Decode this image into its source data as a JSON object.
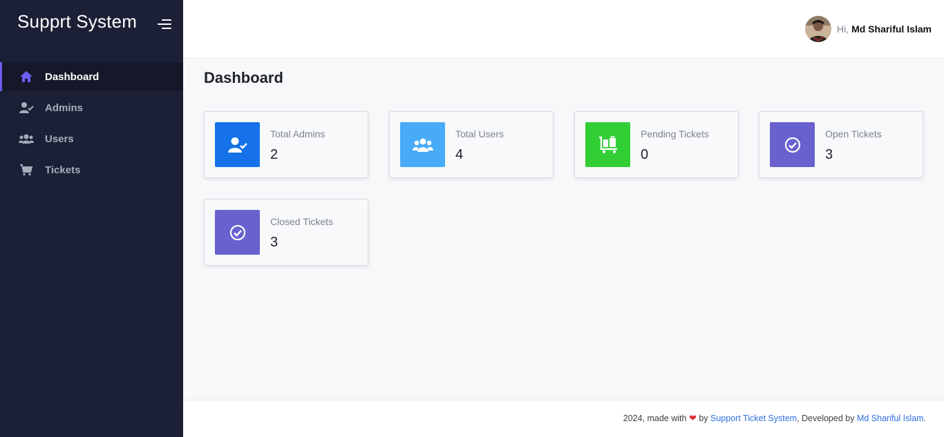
{
  "sidebar": {
    "brand": "Supprt System",
    "items": [
      {
        "label": "Dashboard",
        "icon": "home-icon",
        "active": true
      },
      {
        "label": "Admins",
        "icon": "user-check-icon"
      },
      {
        "label": "Users",
        "icon": "users-icon"
      },
      {
        "label": "Tickets",
        "icon": "cart-icon"
      }
    ]
  },
  "header": {
    "greeting": "Hi,",
    "user_name": "Md Shariful Islam"
  },
  "main": {
    "title": "Dashboard",
    "cards": [
      {
        "label": "Total Admins",
        "value": "2",
        "icon": "user-check-icon",
        "color": "#1572e8"
      },
      {
        "label": "Total Users",
        "value": "4",
        "icon": "users-icon",
        "color": "#48abf7"
      },
      {
        "label": "Pending Tickets",
        "value": "0",
        "icon": "luggage-cart-icon",
        "color": "#31ce36"
      },
      {
        "label": "Open Tickets",
        "value": "3",
        "icon": "check-circle-icon",
        "color": "#6861ce"
      },
      {
        "label": "Closed Tickets",
        "value": "3",
        "icon": "check-circle-icon",
        "color": "#6861ce"
      }
    ]
  },
  "footer": {
    "prefix": "2024, made with",
    "by": "by",
    "project_link": "Support Ticket System",
    "developed_by": ", Developed by",
    "developer_link": "Md Shariful Islam",
    "suffix": "."
  },
  "colors": {
    "sidebar_bg": "#1b2036",
    "accent": "#6c5ff0",
    "link": "#2f6de1"
  }
}
